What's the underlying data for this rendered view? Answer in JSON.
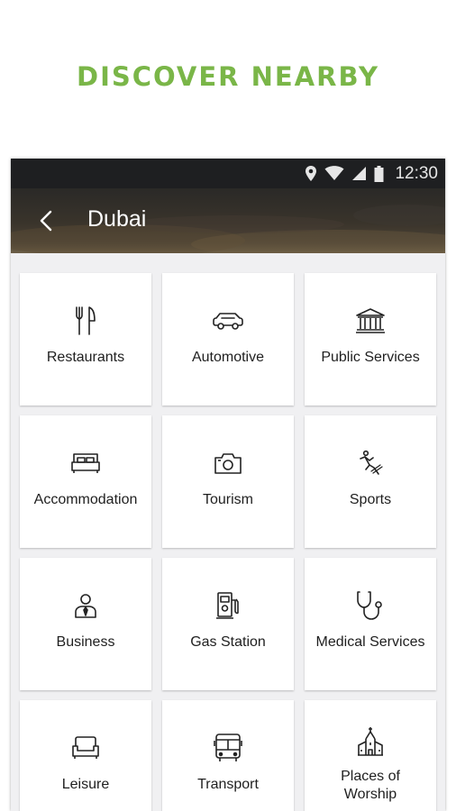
{
  "headline": "DISCOVER NEARBY",
  "status_bar": {
    "time": "12:30"
  },
  "app_bar": {
    "title": "Dubai"
  },
  "colors": {
    "accent_green": "#7ab648",
    "status_bar": "#1e1f21",
    "card_bg": "#ffffff",
    "page_bg": "#f0f0f2"
  },
  "categories": [
    {
      "label": "Restaurants",
      "icon": "fork-knife-icon"
    },
    {
      "label": "Automotive",
      "icon": "car-icon"
    },
    {
      "label": "Public Services",
      "icon": "government-building-icon"
    },
    {
      "label": "Accommodation",
      "icon": "bed-icon"
    },
    {
      "label": "Tourism",
      "icon": "camera-icon"
    },
    {
      "label": "Sports",
      "icon": "runner-icon"
    },
    {
      "label": "Business",
      "icon": "businessman-icon"
    },
    {
      "label": "Gas Station",
      "icon": "fuel-pump-icon"
    },
    {
      "label": "Medical Services",
      "icon": "stethoscope-icon"
    },
    {
      "label": "Leisure",
      "icon": "armchair-icon"
    },
    {
      "label": "Transport",
      "icon": "bus-icon"
    },
    {
      "label": "Places of Worship",
      "icon": "church-icon"
    }
  ]
}
